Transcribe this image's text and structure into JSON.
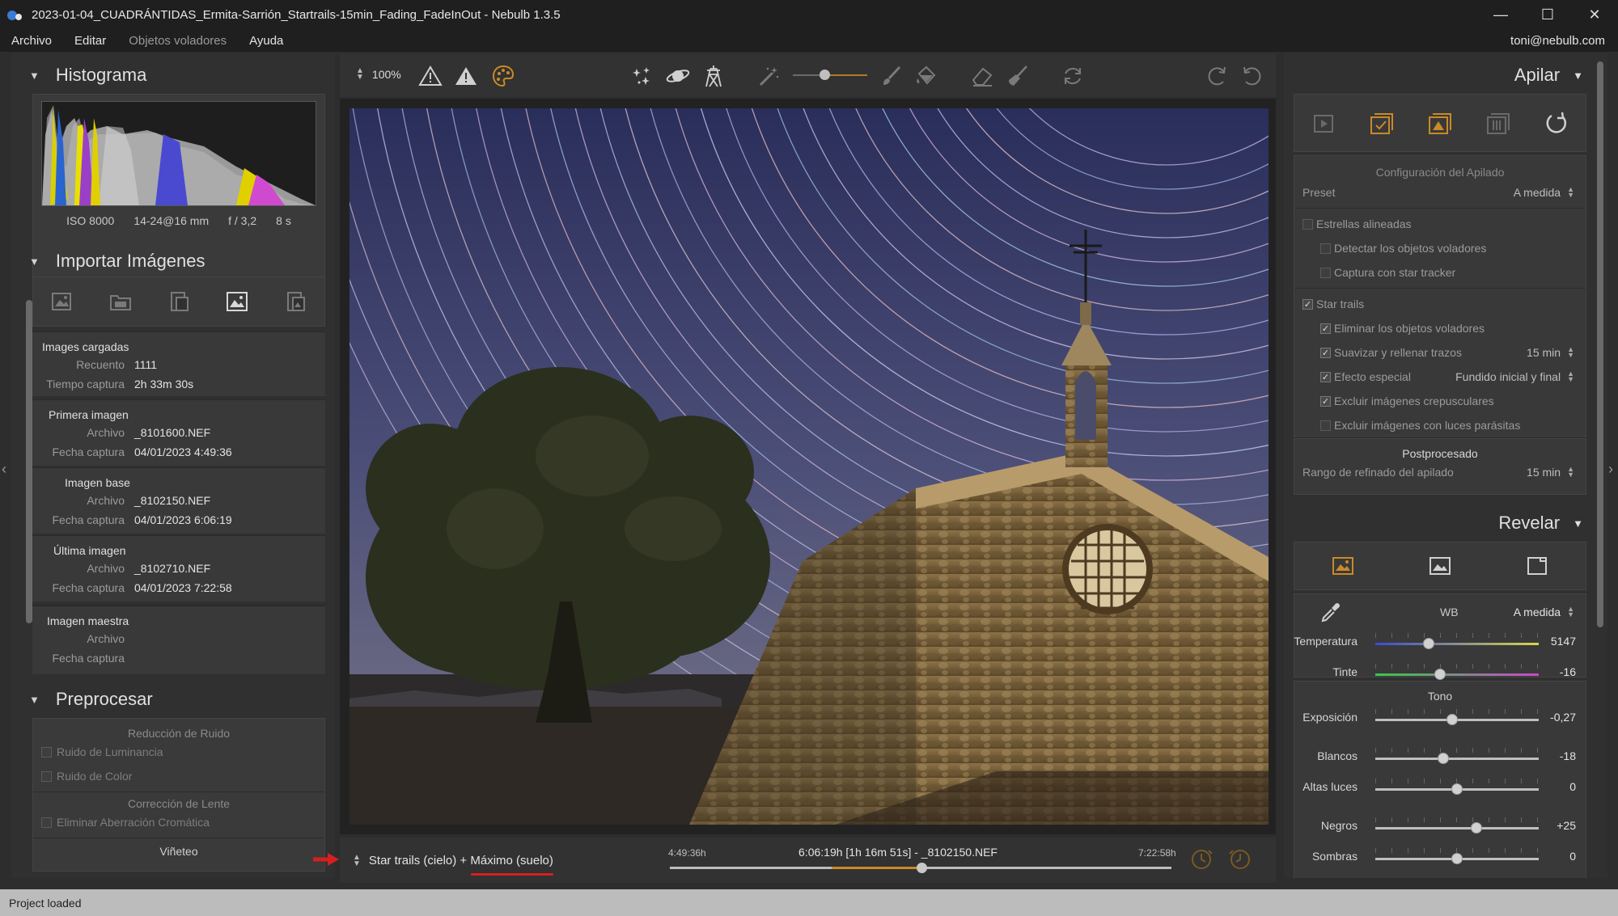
{
  "window": {
    "title": "2023-01-04_CUADRÁNTIDAS_Ermita-Sarrión_Startrails-15min_Fading_FadeInOut - Nebulb 1.3.5",
    "minimize": "—",
    "maximize": "☐",
    "close": "✕"
  },
  "menu": {
    "items": [
      "Archivo",
      "Editar",
      "Objetos voladores",
      "Ayuda"
    ],
    "user": "toni@nebulb.com"
  },
  "left": {
    "histogram": {
      "title": "Histograma",
      "iso": "ISO 8000",
      "lens": "14-24@16 mm",
      "aperture": "f / 3,2",
      "shutter": "8 s"
    },
    "import": {
      "title": "Importar Imágenes",
      "loaded": {
        "heading": "Images cargadas",
        "count_label": "Recuento",
        "count": "1111",
        "time_label": "Tiempo captura",
        "time": "2h 33m 30s"
      },
      "first": {
        "heading": "Primera imagen",
        "file_label": "Archivo",
        "file": "_8101600.NEF",
        "date_label": "Fecha captura",
        "date": "04/01/2023 4:49:36"
      },
      "base": {
        "heading": "Imagen base",
        "file_label": "Archivo",
        "file": "_8102150.NEF",
        "date_label": "Fecha captura",
        "date": "04/01/2023 6:06:19"
      },
      "last": {
        "heading": "Última imagen",
        "file_label": "Archivo",
        "file": "_8102710.NEF",
        "date_label": "Fecha captura",
        "date": "04/01/2023 7:22:58"
      },
      "master": {
        "heading": "Imagen maestra",
        "file_label": "Archivo",
        "date_label": "Fecha captura"
      }
    },
    "preprocess": {
      "title": "Preprocesar",
      "noise_title": "Reducción de Ruido",
      "luminance": "Ruido de Luminancia",
      "color": "Ruido de Color",
      "lens_title": "Corrección de Lente",
      "chromatic": "Eliminar Aberración Cromática",
      "vignette": "Viñeteo"
    }
  },
  "toolbar": {
    "zoom": "100%"
  },
  "bottom": {
    "mode": "Star trails (cielo) + Máximo (suelo)",
    "start": "4:49:36h",
    "current": "6:06:19h [1h 16m 51s] - _8102150.NEF",
    "end": "7:22:58h",
    "position": 0.5
  },
  "right": {
    "stack": {
      "title": "Apilar",
      "config_title": "Configuración del Apilado",
      "preset_label": "Preset",
      "preset_value": "A medida",
      "aligned": "Estrellas alineadas",
      "detect_flying": "Detectar los objetos voladores",
      "tracker": "Captura con star tracker",
      "star_trails": "Star trails",
      "remove_flying": "Eliminar los objetos voladores",
      "smooth": "Suavizar y rellenar trazos",
      "smooth_value": "15 min",
      "effect": "Efecto especial",
      "effect_value": "Fundido inicial y final",
      "exclude_twilight": "Excluir imágenes crepusculares",
      "exclude_lights": "Excluir imágenes con luces parásitas",
      "post_title": "Postprocesado",
      "refine_label": "Rango de refinado del apilado",
      "refine_value": "15 min"
    },
    "develop": {
      "title": "Revelar",
      "wb_label": "WB",
      "wb_value": "A medida",
      "tone_title": "Tono",
      "sliders": [
        {
          "label": "Temperatura",
          "value": "5147",
          "pos": 0.33
        },
        {
          "label": "Tinte",
          "value": "-16",
          "pos": 0.4
        },
        {
          "label": "Exposición",
          "value": "-0,27",
          "pos": 0.47
        },
        {
          "label": "Blancos",
          "value": "-18",
          "pos": 0.42
        },
        {
          "label": "Altas luces",
          "value": "0",
          "pos": 0.5
        },
        {
          "label": "Negros",
          "value": "+25",
          "pos": 0.62
        },
        {
          "label": "Sombras",
          "value": "0",
          "pos": 0.5
        }
      ]
    }
  },
  "status": {
    "text": "Project loaded"
  },
  "colors": {
    "accent": "#c98a27",
    "annotation_red": "#d61f1f"
  }
}
